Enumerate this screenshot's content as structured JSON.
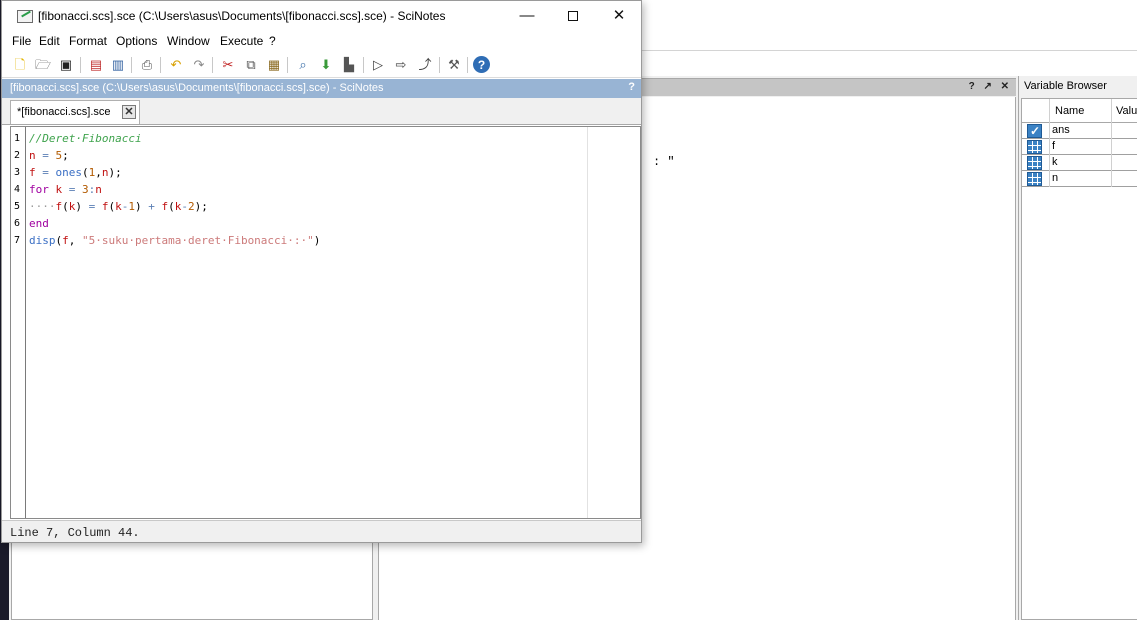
{
  "window": {
    "title": "[fibonacci.scs].sce (C:\\Users\\asus\\Documents\\[fibonacci.scs].sce) - SciNotes",
    "minimize": "—",
    "close": "✕"
  },
  "menu": [
    "File",
    "Edit",
    "Format",
    "Options",
    "Window",
    "Execute",
    "?"
  ],
  "document_bar": {
    "title": "[fibonacci.scs].sce (C:\\Users\\asus\\Documents\\[fibonacci.scs].sce) - SciNotes",
    "help": "?"
  },
  "tab": {
    "label": "*[fibonacci.scs].sce",
    "close": "✕"
  },
  "editor": {
    "line_numbers": [
      "1",
      "2",
      "3",
      "4",
      "5",
      "6",
      "7"
    ],
    "lines": [
      [
        {
          "t": "//Deret·Fibonacci",
          "c": "comment"
        }
      ],
      [
        {
          "t": "n",
          "c": "var"
        },
        {
          "t": " = ",
          "c": "op"
        },
        {
          "t": "5",
          "c": "num"
        },
        {
          "t": ";",
          "c": "txt"
        }
      ],
      [
        {
          "t": "f",
          "c": "var"
        },
        {
          "t": " = ",
          "c": "op"
        },
        {
          "t": "ones",
          "c": "fn"
        },
        {
          "t": "(",
          "c": "txt"
        },
        {
          "t": "1",
          "c": "num"
        },
        {
          "t": ",",
          "c": "txt"
        },
        {
          "t": "n",
          "c": "var"
        },
        {
          "t": ");",
          "c": "txt"
        }
      ],
      [
        {
          "t": "for",
          "c": "kw"
        },
        {
          "t": " ",
          "c": "txt"
        },
        {
          "t": "k",
          "c": "var"
        },
        {
          "t": " = ",
          "c": "op"
        },
        {
          "t": "3",
          "c": "num"
        },
        {
          "t": ":",
          "c": "op"
        },
        {
          "t": "n",
          "c": "var"
        }
      ],
      [
        {
          "t": "····",
          "c": "dot"
        },
        {
          "t": "f",
          "c": "var"
        },
        {
          "t": "(",
          "c": "txt"
        },
        {
          "t": "k",
          "c": "var"
        },
        {
          "t": ")",
          "c": "txt"
        },
        {
          "t": " = ",
          "c": "op"
        },
        {
          "t": "f",
          "c": "var"
        },
        {
          "t": "(",
          "c": "txt"
        },
        {
          "t": "k",
          "c": "var"
        },
        {
          "t": "-",
          "c": "op"
        },
        {
          "t": "1",
          "c": "num"
        },
        {
          "t": ")",
          "c": "txt"
        },
        {
          "t": " + ",
          "c": "op"
        },
        {
          "t": "f",
          "c": "var"
        },
        {
          "t": "(",
          "c": "txt"
        },
        {
          "t": "k",
          "c": "var"
        },
        {
          "t": "-",
          "c": "op"
        },
        {
          "t": "2",
          "c": "num"
        },
        {
          "t": ");",
          "c": "txt"
        }
      ],
      [
        {
          "t": "end",
          "c": "kw"
        }
      ],
      [
        {
          "t": "disp",
          "c": "fn"
        },
        {
          "t": "(",
          "c": "txt"
        },
        {
          "t": "f",
          "c": "var"
        },
        {
          "t": ", ",
          "c": "txt"
        },
        {
          "t": "\"5·suku·pertama·deret·Fibonacci·:·\"",
          "c": "str"
        },
        {
          "t": ")",
          "c": "txt"
        }
      ]
    ]
  },
  "status": "Line 7, Column 44.",
  "console": {
    "text": ": \"",
    "controls": "? ↗ ✕"
  },
  "variable_browser": {
    "title": "Variable Browser",
    "columns": {
      "name": "Name",
      "value": "Value"
    },
    "rows": [
      {
        "name": "ans",
        "icon": "check-icon"
      },
      {
        "name": "f",
        "icon": "matrix-icon"
      },
      {
        "name": "k",
        "icon": "matrix-icon"
      },
      {
        "name": "n",
        "icon": "matrix-icon"
      }
    ]
  },
  "toolbar_icons": [
    "new-file-icon",
    "open-icon",
    "open-folder-icon",
    "save-icon",
    "save-as-icon",
    "print-icon",
    "undo-icon",
    "redo-icon",
    "cut-icon",
    "copy-icon",
    "paste-icon",
    "find-icon",
    "download-icon",
    "execute-file-icon",
    "run-icon",
    "run-selection-icon",
    "run-all-icon",
    "preferences-icon",
    "help-icon"
  ],
  "colors": {
    "doc_bar": "#98b4d4",
    "comment": "#3fa34d",
    "variable": "#c01010",
    "keyword": "#a000a0",
    "function": "#3b6fc4",
    "string": "#cc7a7a",
    "number": "#b25a00"
  }
}
